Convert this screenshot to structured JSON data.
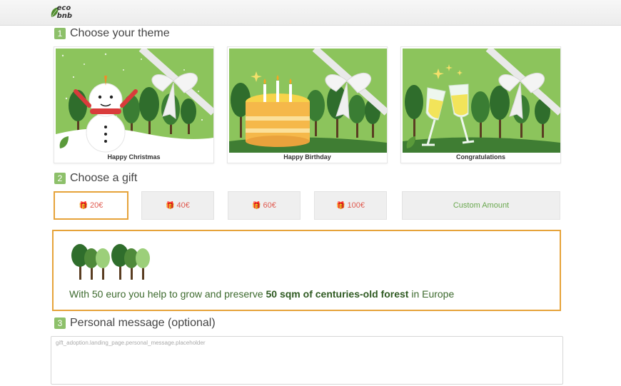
{
  "header": {
    "logo_text": "eco bnb"
  },
  "steps": {
    "theme": {
      "number": "1",
      "title": "Choose your theme"
    },
    "gift": {
      "number": "2",
      "title": "Choose a gift"
    },
    "message": {
      "number": "3",
      "title": "Personal message (optional)"
    }
  },
  "themes": [
    {
      "label": "Happy Christmas"
    },
    {
      "label": "Happy Birthday"
    },
    {
      "label": "Congratulations"
    }
  ],
  "gifts": [
    {
      "label": "20€",
      "selected": true
    },
    {
      "label": "40€"
    },
    {
      "label": "60€"
    },
    {
      "label": "100€"
    },
    {
      "label": "Custom Amount"
    }
  ],
  "info": {
    "text_before": "With 50 euro you help to grow and preserve ",
    "text_bold": "50 sqm of centuries-old forest",
    "text_after": " in Europe"
  },
  "message": {
    "placeholder": "gift_adoption.landing_page.personal_message.placeholder",
    "value": ""
  },
  "colors": {
    "accent_green": "#8dc06a",
    "selected_border": "#e6a33a",
    "gift_red": "#e05a4f",
    "card_green": "#8cc45c"
  }
}
